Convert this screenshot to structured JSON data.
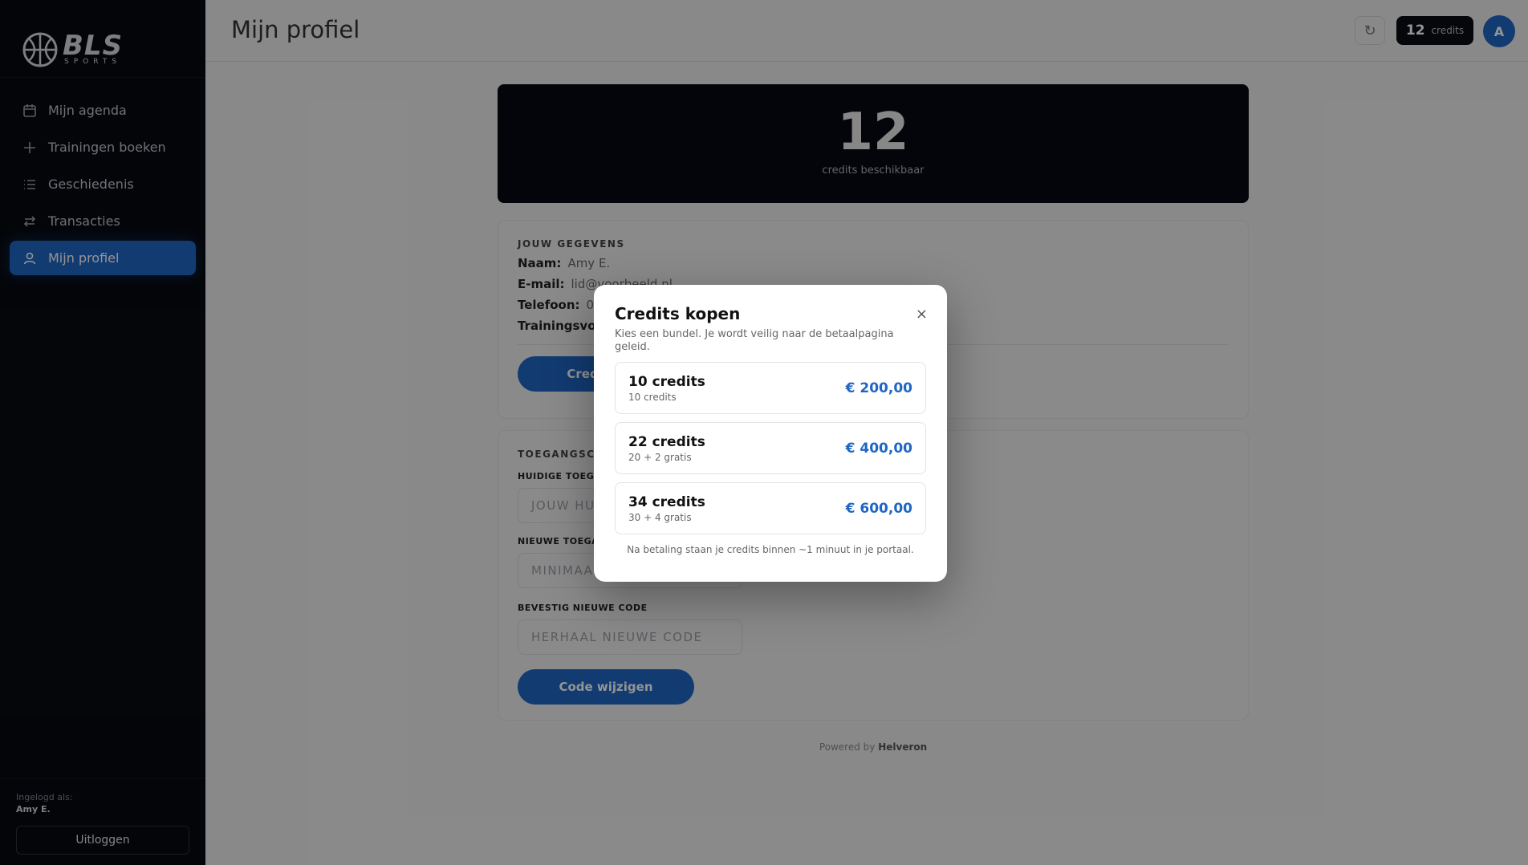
{
  "brand": {
    "logo_big": "BLS",
    "logo_small": "SPORTS"
  },
  "sidebar": {
    "items": [
      {
        "label": "Mijn agenda",
        "icon": "calendar-icon"
      },
      {
        "label": "Trainingen boeken",
        "icon": "plus-icon"
      },
      {
        "label": "Geschiedenis",
        "icon": "list-icon"
      },
      {
        "label": "Transacties",
        "icon": "swap-icon"
      },
      {
        "label": "Mijn profiel",
        "icon": "user-icon",
        "active": true
      }
    ],
    "logged_in_label": "Ingelogd als:",
    "logged_in_user": "Amy E.",
    "logout_label": "Uitloggen"
  },
  "header": {
    "title": "Mijn profiel",
    "refresh_icon": "↻",
    "credits_count": "12",
    "credits_label": "credits",
    "avatar_initial": "A"
  },
  "hero": {
    "credits": "12",
    "label": "credits beschikbaar"
  },
  "profile": {
    "section_title": "JOUW GEGEVENS",
    "name_label": "Naam:",
    "name_value": "Amy E.",
    "email_label": "E-mail:",
    "email_value": "lid@voorbeeld.nl",
    "phone_label": "Telefoon:",
    "phone_value": "06",
    "training_label": "Trainingsvorm",
    "buy_button": "Credits kopen"
  },
  "access": {
    "section_title": "TOEGANGSCODE",
    "current_label": "HUIDIGE TOEGANGSCODE",
    "current_placeholder": "JOUW HUIDIGE CODE",
    "new_label": "NIEUWE TOEGANGSCODE",
    "new_placeholder": "MINIMAAL 4 CIJFERS",
    "confirm_label": "BEVESTIG NIEUWE CODE",
    "confirm_placeholder": "HERHAAL NIEUWE CODE",
    "change_button": "Code wijzigen"
  },
  "footer": {
    "powered_by": "Powered by",
    "brand": "Helveron"
  },
  "modal": {
    "title": "Credits kopen",
    "close": "×",
    "description": "Kies een bundel. Je wordt veilig naar de betaalpagina geleid.",
    "bundles": [
      {
        "title": "10 credits",
        "sub": "10 credits",
        "price": "€ 200,00"
      },
      {
        "title": "22 credits",
        "sub": "20 + 2 gratis",
        "price": "€ 400,00"
      },
      {
        "title": "34 credits",
        "sub": "30 + 4 gratis",
        "price": "€ 600,00"
      }
    ],
    "note": "Na betaling staan je credits binnen ~1 minuut in je portaal."
  },
  "colors": {
    "accent": "#1f66c4",
    "sidebar_bg": "#070a11",
    "hero_bg": "#070a12"
  }
}
